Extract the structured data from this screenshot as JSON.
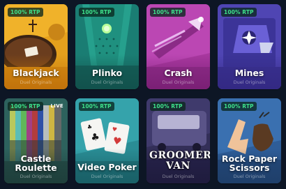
{
  "games": [
    {
      "title": "Blackjack",
      "subtitle": "Duel Originals",
      "rtp": "100% RTP"
    },
    {
      "title": "Plinko",
      "subtitle": "Duel Originals",
      "rtp": "100% RTP"
    },
    {
      "title": "Crash",
      "subtitle": "Duel Originals",
      "rtp": "100% RTP"
    },
    {
      "title": "Mines",
      "subtitle": "Duel Originals",
      "rtp": "100% RTP"
    },
    {
      "title_line1": "Castle",
      "title_line2": "Roulette",
      "subtitle": "Duel Originals",
      "rtp": "100% RTP",
      "badge": "LIVE"
    },
    {
      "title": "Video Poker",
      "subtitle": "Duel Originals",
      "rtp": "100% RTP"
    },
    {
      "title": "",
      "subtitle": "Duel Originals",
      "rtp": "100% RTP",
      "logo_text": "GROOMER'S VAN"
    },
    {
      "title_line1": "Rock Paper",
      "title_line2": "Scissors",
      "subtitle": "Duel Originals",
      "rtp": "100% RTP"
    }
  ],
  "colors": {
    "background": "#0d1625",
    "rtp_text": "#3ee08a",
    "blackjack": "#e8a21c",
    "plinko": "#1c8a7a",
    "crash": "#b33fb0",
    "mines": "#5a4fc0",
    "castle_roulette": "#2f6a64",
    "video_poker": "#2a8e96",
    "groomers_van": "#3a3560",
    "rock_paper_scissors": "#2f5f9a"
  }
}
